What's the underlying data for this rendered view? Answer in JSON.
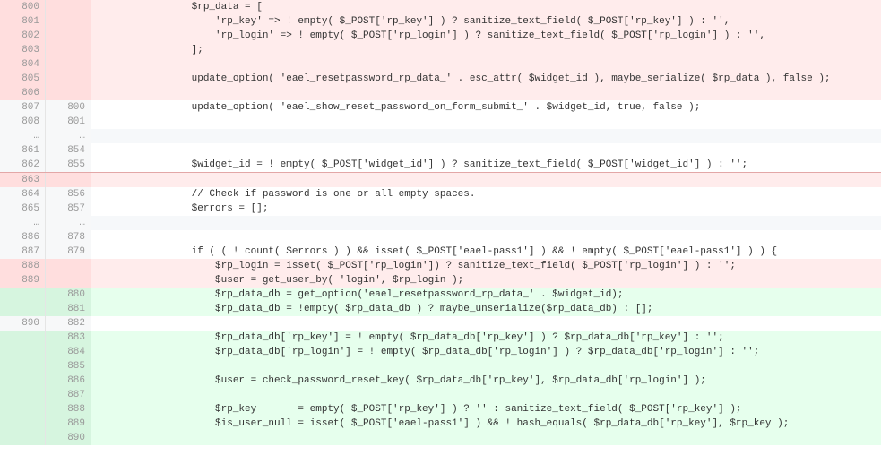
{
  "indent1": "                ",
  "indent2": "                    ",
  "lines": [
    {
      "t": "del",
      "o": "800",
      "n": "",
      "html": "{i1}$rp_data = ["
    },
    {
      "t": "del",
      "o": "801",
      "n": "",
      "html": "{i2}'rp_key' => ! empty( $_POST['rp_key'] ) ? sanitize_text_field( $_POST['rp_key'] ) : '',"
    },
    {
      "t": "del",
      "o": "802",
      "n": "",
      "html": "{i2}'rp_login' => ! empty( $_POST['rp_login'] ) ? sanitize_text_field( $_POST['rp_login'] ) : '',"
    },
    {
      "t": "del",
      "o": "803",
      "n": "",
      "html": "{i1}];"
    },
    {
      "t": "del",
      "o": "804",
      "n": "",
      "html": ""
    },
    {
      "t": "del",
      "o": "805",
      "n": "",
      "html": "{i1}update_option( 'eael_resetpassword_rp_data_' . esc_attr( $widget_id ), maybe_serialize( $rp_data ), false );"
    },
    {
      "t": "del",
      "o": "806",
      "n": "",
      "html": ""
    },
    {
      "t": "ctx",
      "o": "807",
      "n": "800",
      "html": "{i1}update_option( 'eael_show_reset_password_on_form_submit_' . $widget_id, true, false );"
    },
    {
      "t": "ctx",
      "o": "808",
      "n": "801",
      "html": ""
    },
    {
      "t": "sep",
      "o": "…",
      "n": "…",
      "html": ""
    },
    {
      "t": "ctx",
      "o": "861",
      "n": "854",
      "html": ""
    },
    {
      "t": "ctx",
      "o": "862",
      "n": "855",
      "html": "{i1}$widget_id = ! empty( $_POST['widget_id'] ) ? sanitize_text_field( $_POST['widget_id'] ) : '';"
    },
    {
      "t": "del",
      "o": "863",
      "n": "",
      "cls": "block-top",
      "html": ""
    },
    {
      "t": "ctx",
      "o": "864",
      "n": "856",
      "html": "{i1}// Check if password is one or all empty spaces."
    },
    {
      "t": "ctx",
      "o": "865",
      "n": "857",
      "html": "{i1}$errors = [];"
    },
    {
      "t": "sep",
      "o": "…",
      "n": "…",
      "html": ""
    },
    {
      "t": "ctx",
      "o": "886",
      "n": "878",
      "html": ""
    },
    {
      "t": "ctx",
      "o": "887",
      "n": "879",
      "html": "{i1}if ( ( ! count( $errors ) ) && isset( $_POST['eael-pass1'] ) && ! empty( $_POST['eael-pass1'] ) ) {"
    },
    {
      "t": "del",
      "o": "888",
      "n": "",
      "html": "{i2}$rp_login = isset( $_POST['rp_login']) ? sanitize_text_field( $_POST['rp_login'] ) : '';"
    },
    {
      "t": "del",
      "o": "889",
      "n": "",
      "html": "{i2}$user = get_user_by( 'login', $rp_login );"
    },
    {
      "t": "add",
      "o": "",
      "n": "880",
      "html": "{i2}$rp_data_db = get_option('eael_resetpassword_rp_data_' . $widget_id);"
    },
    {
      "t": "add",
      "o": "",
      "n": "881",
      "html": "{i2}$rp_data_db = !empty( $rp_data_db ) ? maybe_unserialize($rp_data_db) : [];"
    },
    {
      "t": "ctx",
      "o": "890",
      "n": "882",
      "html": ""
    },
    {
      "t": "add",
      "o": "",
      "n": "883",
      "html": "{i2}$rp_data_db['rp_key'] = ! empty( $rp_data_db['rp_key'] ) ? $rp_data_db['rp_key'] : '';"
    },
    {
      "t": "add",
      "o": "",
      "n": "884",
      "html": "{i2}$rp_data_db['rp_login'] = ! empty( $rp_data_db['rp_login'] ) ? $rp_data_db['rp_login'] : '';"
    },
    {
      "t": "add",
      "o": "",
      "n": "885",
      "html": ""
    },
    {
      "t": "add",
      "o": "",
      "n": "886",
      "html": "{i2}$user = check_password_reset_key( $rp_data_db['rp_key'], $rp_data_db['rp_login'] );"
    },
    {
      "t": "add",
      "o": "",
      "n": "887",
      "html": ""
    },
    {
      "t": "add",
      "o": "",
      "n": "888",
      "html": "{i2}$rp_key       = empty( $_POST['rp_key'] ) ? '' : sanitize_text_field( $_POST['rp_key'] );"
    },
    {
      "t": "add",
      "o": "",
      "n": "889",
      "html": "{i2}$is_user_null = isset( $_POST['eael-pass1'] ) && ! hash_equals( $rp_data_db['rp_key'], $rp_key );"
    },
    {
      "t": "add",
      "o": "",
      "n": "890",
      "html": ""
    }
  ]
}
